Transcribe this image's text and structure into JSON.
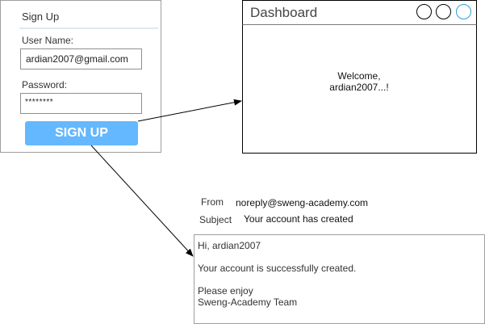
{
  "signup": {
    "title": "Sign Up",
    "username_label": "User Name:",
    "username_value": "ardian2007@gmail.com",
    "password_label": "Password:",
    "password_value": "********",
    "button_label": "SIGN UP",
    "button_color": "#63b8ff"
  },
  "dashboard": {
    "title": "Dashboard",
    "welcome_line1": "Welcome,",
    "welcome_line2": "ardian2007...!",
    "window_buttons": [
      "circle",
      "circle",
      "circle-blue"
    ],
    "accent_color": "#2a9fd8"
  },
  "email": {
    "from_label": "From",
    "from_value": "noreply@sweng-academy.com",
    "subject_label": "Subject",
    "subject_value": "Your account has created",
    "greeting": "Hi, ardian2007",
    "message": "Your account is successfully created.",
    "closing_line1": "Please enjoy",
    "closing_line2": "Sweng-Academy Team"
  }
}
